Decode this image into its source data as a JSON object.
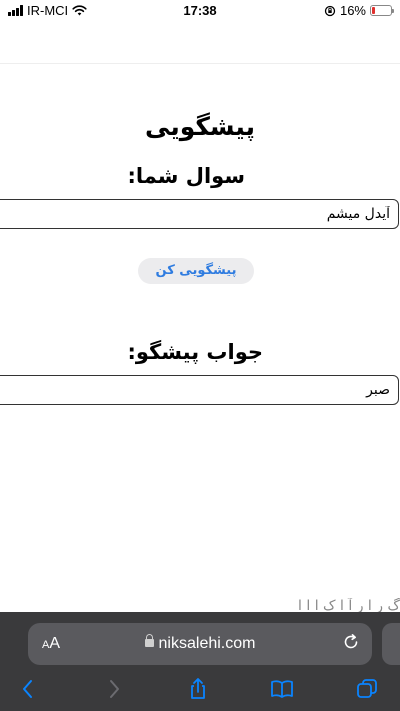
{
  "status_bar": {
    "carrier": "IR-MCI",
    "time": "17:38",
    "battery_percent": "16%",
    "battery_level": 0.16,
    "battery_color": "#e0302e"
  },
  "page": {
    "title": "پیشگویی",
    "question_label": "سوال شما:",
    "question_value": "آیدل میشم",
    "predict_button": "پیشگویی کن",
    "answer_label": "جواب پیشگو:",
    "answer_value": "صبر",
    "footer_text_partial": "گ ر ا ر آ ا ک ا ا ا"
  },
  "browser": {
    "aa_label": "AA",
    "url": "niksalehi.com",
    "toolbar": [
      "back-icon",
      "forward-icon",
      "share-icon",
      "bookmarks-icon",
      "tabs-icon"
    ],
    "accent_color": "#0a84ff"
  }
}
